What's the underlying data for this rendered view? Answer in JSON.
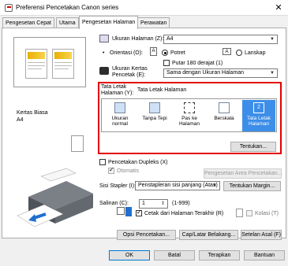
{
  "window": {
    "title": "Preferensi Pencetakan Canon                series",
    "close_glyph": "✕"
  },
  "tabs": [
    {
      "label": "Pengesetan Cepat"
    },
    {
      "label": "Utama"
    },
    {
      "label": "Pengesetan Halaman"
    },
    {
      "label": "Perawatan"
    }
  ],
  "left_panel": {
    "media_label": "Kertas Biasa",
    "media_size": "A4"
  },
  "page_setup": {
    "page_size_label": "Ukuran Halaman (Z):",
    "page_size_value": "A4",
    "orientation_label": "Orientasi (O):",
    "portrait_label": "Potret",
    "landscape_label": "Lanskap",
    "rotate_label": "Putar 180 derajat (1)",
    "printer_paper_label_1": "Ukuran Kertas",
    "printer_paper_label_2": "Pencetak (E):",
    "printer_paper_value": "Sama dengan Ukuran Halaman",
    "layout_label_1": "Tata Letak",
    "layout_label_2": "Halaman (Y):",
    "layout_label_3": "Tata Letak Halaman",
    "layout_options": [
      {
        "label": "Ukuran normal"
      },
      {
        "label": "Tanpa Tepi"
      },
      {
        "label": "Pas ke Halaman"
      },
      {
        "label": "Berskala"
      },
      {
        "label": "Tata Letak Halaman"
      }
    ],
    "layout_selected_index": 4,
    "layout_selected_badge": "2",
    "specify_button": "Tentukan...",
    "duplex_label": "Pencetakan Dupleks (X)",
    "auto_label": "Otomatis",
    "print_area_button": "Pengesetan Area Pencetakan...",
    "stapling_label": "Sisi Stapler (I):",
    "stapling_value": "Penstapleran sisi panjang (Atas)",
    "margin_button": "Tentukan Margin...",
    "copies_label": "Salinan (C):",
    "copies_value": "1",
    "copies_range": "(1-999)",
    "reverse_label": "Cetak dari Halaman Terakhir (R)",
    "collate_label": "Kolasi (T)",
    "print_options_button": "Opsi Pencetakan...",
    "stamp_button": "Cap/Latar Belakang...",
    "defaults_button": "Setelan Asal (F)"
  },
  "footer": {
    "ok": "OK",
    "cancel": "Batal",
    "apply": "Terapkan",
    "help": "Bantuan"
  },
  "colors": {
    "highlight_border": "#e30000",
    "selected_item": "#3c8ee8"
  }
}
